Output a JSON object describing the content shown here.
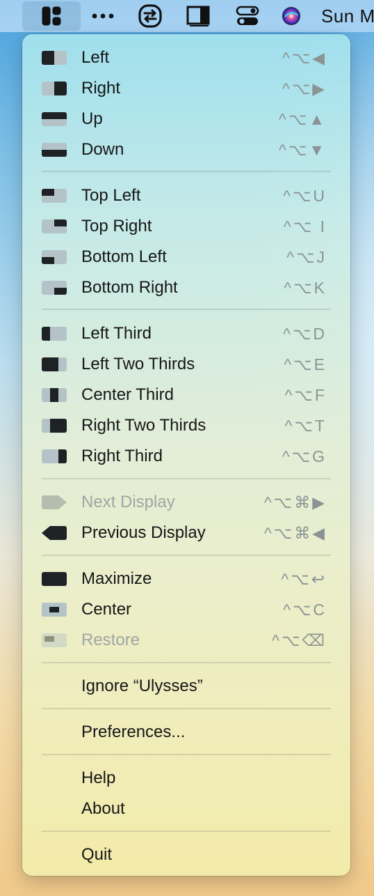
{
  "menubar": {
    "clock": "Sun M",
    "icons": [
      "rectangle-app-icon",
      "more-dots-icon",
      "sync-icon",
      "sidebar-window-icon",
      "control-center-icon",
      "siri-icon"
    ]
  },
  "menu": {
    "items": [
      {
        "label": "Left",
        "shortcut": "^⌥◀",
        "icon": "left-half-icon",
        "enabled": true
      },
      {
        "label": "Right",
        "shortcut": "^⌥▶",
        "icon": "right-half-icon",
        "enabled": true
      },
      {
        "label": "Up",
        "shortcut": "^⌥▲",
        "icon": "top-half-icon",
        "enabled": true
      },
      {
        "label": "Down",
        "shortcut": "^⌥▼",
        "icon": "bottom-half-icon",
        "enabled": true
      },
      {
        "label": "Top Left",
        "shortcut": "^⌥U",
        "icon": "top-left-icon",
        "enabled": true
      },
      {
        "label": "Top Right",
        "shortcut": "^⌥ I",
        "icon": "top-right-icon",
        "enabled": true
      },
      {
        "label": "Bottom Left",
        "shortcut": "^⌥J",
        "icon": "bottom-left-icon",
        "enabled": true
      },
      {
        "label": "Bottom Right",
        "shortcut": "^⌥K",
        "icon": "bottom-right-icon",
        "enabled": true
      },
      {
        "label": "Left Third",
        "shortcut": "^⌥D",
        "icon": "left-third-icon",
        "enabled": true
      },
      {
        "label": "Left Two Thirds",
        "shortcut": "^⌥E",
        "icon": "left-two-thirds-icon",
        "enabled": true
      },
      {
        "label": "Center Third",
        "shortcut": "^⌥F",
        "icon": "center-third-icon",
        "enabled": true
      },
      {
        "label": "Right Two Thirds",
        "shortcut": "^⌥T",
        "icon": "right-two-thirds-icon",
        "enabled": true
      },
      {
        "label": "Right Third",
        "shortcut": "^⌥G",
        "icon": "right-third-icon",
        "enabled": true
      },
      {
        "label": "Next Display",
        "shortcut": "^⌥⌘▶",
        "icon": "next-display-icon",
        "enabled": false
      },
      {
        "label": "Previous Display",
        "shortcut": "^⌥⌘◀",
        "icon": "previous-display-icon",
        "enabled": true
      },
      {
        "label": "Maximize",
        "shortcut": "^⌥↩",
        "icon": "maximize-icon",
        "enabled": true
      },
      {
        "label": "Center",
        "shortcut": "^⌥C",
        "icon": "center-icon",
        "enabled": true
      },
      {
        "label": "Restore",
        "shortcut": "^⌥⌫",
        "icon": "restore-icon",
        "enabled": false
      },
      {
        "label": "Ignore “Ulysses”",
        "shortcut": "",
        "icon": "",
        "enabled": true
      },
      {
        "label": "Preferences...",
        "shortcut": "",
        "icon": "",
        "enabled": true
      },
      {
        "label": "Help",
        "shortcut": "",
        "icon": "",
        "enabled": true
      },
      {
        "label": "About",
        "shortcut": "",
        "icon": "",
        "enabled": true
      },
      {
        "label": "Quit",
        "shortcut": "",
        "icon": "",
        "enabled": true
      }
    ]
  }
}
